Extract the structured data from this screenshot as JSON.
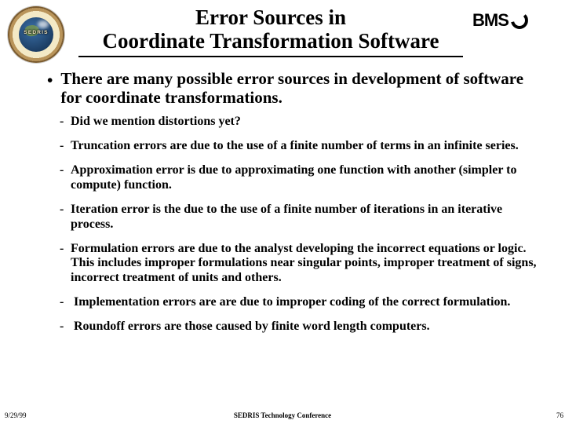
{
  "header": {
    "title_line1": "Error Sources in",
    "title_line2": "Coordinate Transformation Software",
    "logo_left_label": "SEDRIS",
    "logo_right_text": "BMS"
  },
  "content": {
    "main_bullet": "There are many possible error sources in development of software for coordinate transformations.",
    "sub_bullets": [
      "Did we mention distortions yet?",
      "Truncation errors are due to the use of a finite number of terms in an infinite series.",
      "Approximation error is due to approximating one function with another (simpler to compute) function.",
      "Iteration error is the due to the use of a finite number of iterations in an iterative process.",
      "Formulation errors are due to the analyst developing the incorrect equations or logic. This includes improper formulations near singular points, improper treatment of signs, incorrect treatment of units and others.",
      "Implementation errors are are due to improper coding of the correct formulation.",
      "Roundoff errors are those caused by finite word length computers."
    ]
  },
  "footer": {
    "date": "9/29/99",
    "center": "SEDRIS Technology Conference",
    "pagenum": "76"
  }
}
